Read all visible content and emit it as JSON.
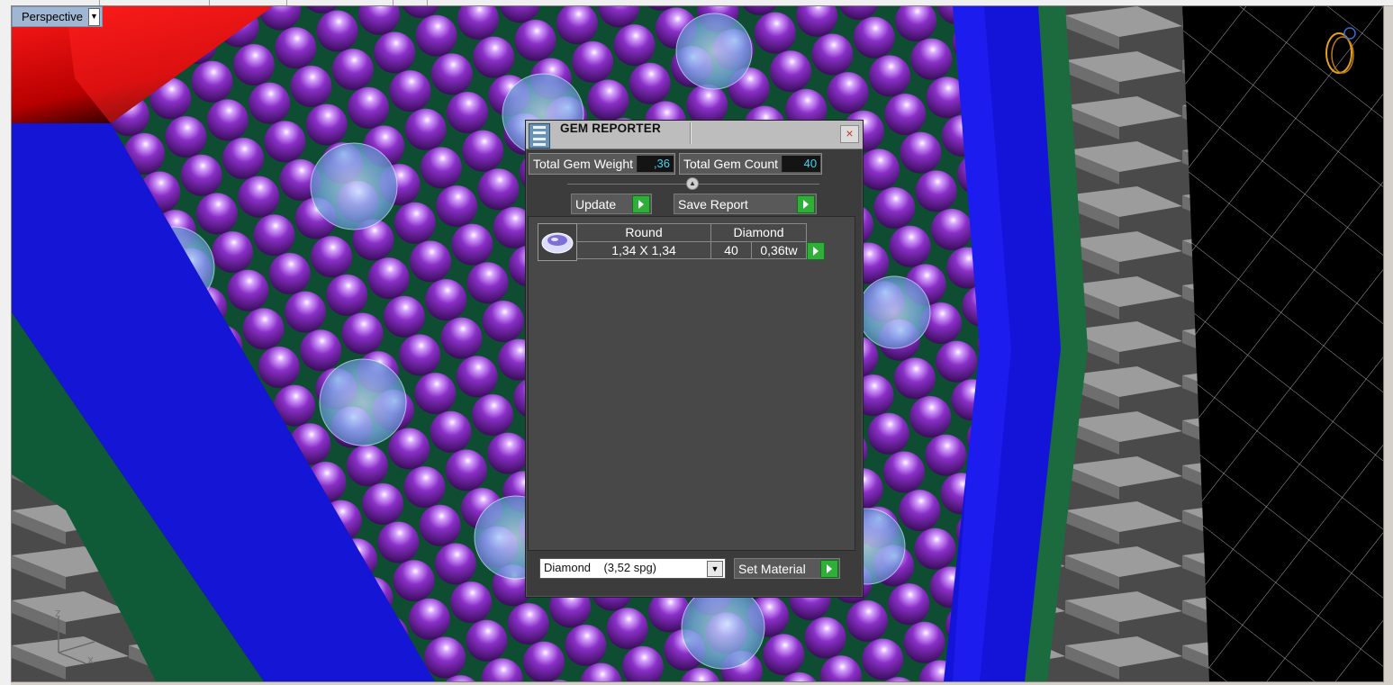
{
  "viewport": {
    "label": "Perspective",
    "axis_labels": {
      "z": "z",
      "x": "x"
    }
  },
  "gem_reporter": {
    "title": "GEM REPORTER",
    "close_label": "×",
    "total_weight_label": "Total Gem Weight",
    "total_weight_value": ",36",
    "total_count_label": "Total Gem Count",
    "total_count_value": "40",
    "update_label": "Update",
    "save_report_label": "Save Report",
    "gems": [
      {
        "shape": "Round",
        "material": "Diamond",
        "size": "1,34 X 1,34",
        "count": "40",
        "weight": "0,36tw"
      }
    ],
    "material_select_value": "Diamond    (3,52 spg)",
    "set_material_label": "Set Material"
  },
  "colors": {
    "accent_green": "#2fae3a",
    "value_cyan": "#45d4f2",
    "panel": "#3c3c3c"
  }
}
